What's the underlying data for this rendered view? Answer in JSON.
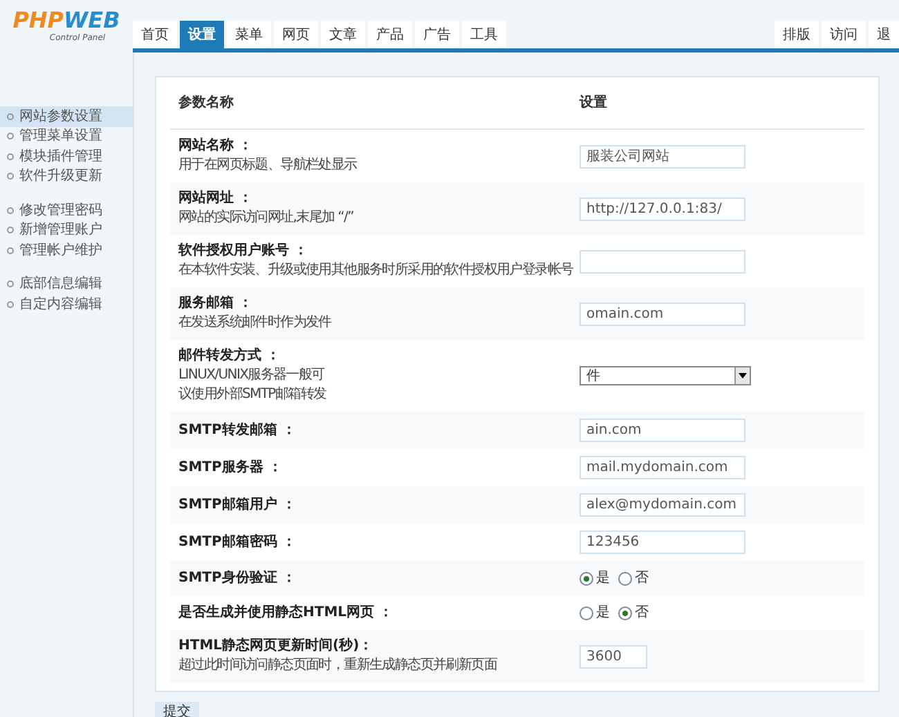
{
  "logo": {
    "part_1": "PHP",
    "part_2": "WEB",
    "subtitle": "Control Panel"
  },
  "tabs": [
    {
      "label": "首页",
      "selected": false
    },
    {
      "label": "设置",
      "selected": true
    },
    {
      "label": "菜单",
      "selected": false
    },
    {
      "label": "网页",
      "selected": false
    },
    {
      "label": "文章",
      "selected": false
    },
    {
      "label": "产品",
      "selected": false
    },
    {
      "label": "广告",
      "selected": false
    },
    {
      "label": "工具",
      "selected": false
    }
  ],
  "right_tabs": [
    "排版",
    "访问",
    "退"
  ],
  "sidebar": {
    "groups": [
      [
        {
          "label": "网站参数设置",
          "selected": true
        },
        {
          "label": "管理菜单设置",
          "selected": false
        },
        {
          "label": "模块插件管理",
          "selected": false
        },
        {
          "label": "软件升级更新",
          "selected": false
        }
      ],
      [
        {
          "label": "修改管理密码",
          "selected": false
        },
        {
          "label": "新增管理账户",
          "selected": false
        },
        {
          "label": "管理帐户维护",
          "selected": false
        }
      ],
      [
        {
          "label": "底部信息编辑",
          "selected": false
        },
        {
          "label": "自定内容编辑",
          "selected": false
        }
      ]
    ]
  },
  "table": {
    "columns": [
      "参数名称",
      "设置"
    ],
    "rows": [
      {
        "label": "网站名称 ：",
        "desc": [
          "用于在网页标题、导航栏处显示"
        ],
        "kind": "text",
        "value": "服装公司网站"
      },
      {
        "label": "网站网址 ：",
        "desc": [
          "网站的实际访问网址,末尾加 “/”"
        ],
        "kind": "text",
        "value": "http://127.0.0.1:83/"
      },
      {
        "label": "软件授权用户账号 ：",
        "desc": [
          "在本软件安装、升级或使用其他服务时所采用的软件授权用户登录帐号"
        ],
        "kind": "text"
      },
      {
        "label": "服务邮箱 ：",
        "desc": [
          "在发送系统邮件时作为发件"
        ],
        "kind": "text",
        "value": "omain.com"
      },
      {
        "label": "邮件转发方式 ：",
        "desc": [
          "LINUX/UNIX服务器一般可",
          "议使用外部SMTP邮箱转发"
        ],
        "kind": "select",
        "value": "件"
      },
      {
        "label": "SMTP转发邮箱 ：",
        "kind": "text",
        "value": "ain.com"
      },
      {
        "label": "SMTP服务器 ：",
        "kind": "text",
        "value": "mail.mydomain.com"
      },
      {
        "label": "SMTP邮箱用户 ：",
        "kind": "text",
        "value": "alex@mydomain.com"
      },
      {
        "label": "SMTP邮箱密码 ：",
        "kind": "text",
        "value": "123456"
      },
      {
        "label": "SMTP身份验证 ：",
        "kind": "radio",
        "options": [
          {
            "label": "是",
            "selected": true
          },
          {
            "label": "否",
            "selected": false
          }
        ]
      },
      {
        "label": "是否生成并使用静态HTML网页 ：",
        "kind": "radio",
        "options": [
          {
            "label": "是",
            "selected": false
          },
          {
            "label": "否",
            "selected": true
          }
        ]
      },
      {
        "label": "HTML静态网页更新时间(秒)：",
        "desc": [
          "超过此时间访问静态页面时，重新生成静态页并刷新页面"
        ],
        "kind": "short_text",
        "value": "3600"
      }
    ]
  },
  "submit": "提交"
}
